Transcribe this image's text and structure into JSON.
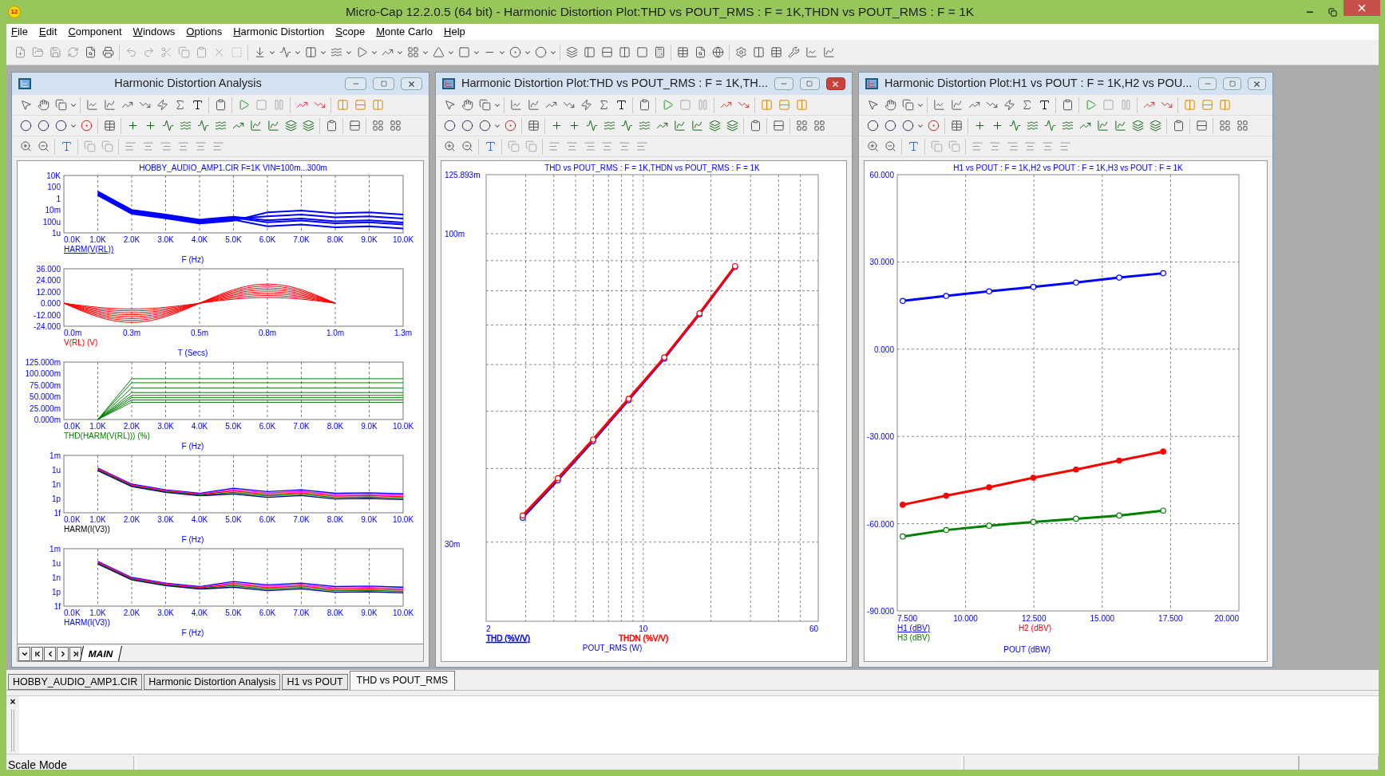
{
  "window": {
    "app_icon": "12",
    "title": "Micro-Cap 12.2.0.5 (64 bit) - Harmonic Distortion Plot:THD vs POUT_RMS : F = 1K,THDN vs POUT_RMS : F = 1K"
  },
  "menu": [
    "File",
    "Edit",
    "Component",
    "Windows",
    "Options",
    "Harmonic Distortion",
    "Scope",
    "Monte Carlo",
    "Help"
  ],
  "child_windows": [
    {
      "kind": "analysis",
      "title": "Harmonic Distortion Analysis",
      "active": false,
      "plot_title": "HOBBY_AUDIO_AMP1.CIR F=1K VIN=100m...300m",
      "page_tab": "MAIN",
      "plots": [
        {
          "kind": "spectrum",
          "yticks": [
            "10K",
            "100",
            "1",
            "10m",
            "100u",
            "1u"
          ],
          "xticks": [
            "0.0K",
            "1.0K",
            "2.0K",
            "3.0K",
            "4.0K",
            "5.0K",
            "6.0K",
            "7.0K",
            "8.0K",
            "9.0K",
            "10.0K"
          ],
          "legend": [
            {
              "text": "HARM(V(RL))",
              "color": "#0000ff",
              "selected": true
            }
          ],
          "xlabel": "F (Hz)"
        },
        {
          "kind": "sine",
          "yticks": [
            "36.000",
            "24.000",
            "12.000",
            "0.000",
            "-12.000",
            "-24.000"
          ],
          "xticks": [
            "0.0m",
            "0.3m",
            "0.5m",
            "0.8m",
            "1.0m",
            "1.3m"
          ],
          "legend": [
            {
              "text": "V(RL) (V)",
              "color": "#ff0000",
              "selected": false
            }
          ],
          "xlabel": "T (Secs)"
        },
        {
          "kind": "thd",
          "yticks": [
            "125.000m",
            "100.000m",
            "75.000m",
            "50.000m",
            "25.000m",
            "0.000m"
          ],
          "xticks": [
            "0.0K",
            "1.0K",
            "2.0K",
            "3.0K",
            "4.0K",
            "5.0K",
            "6.0K",
            "7.0K",
            "8.0K",
            "9.0K",
            "10.0K"
          ],
          "legend": [
            {
              "text": "THD(HARM(V(RL))) (%)",
              "color": "#008000",
              "selected": false
            }
          ],
          "xlabel": "F (Hz)"
        },
        {
          "kind": "multi",
          "yticks": [
            "1m",
            "1u",
            "1n",
            "1p",
            "1f"
          ],
          "xticks": [
            "0.0K",
            "1.0K",
            "2.0K",
            "3.0K",
            "4.0K",
            "5.0K",
            "6.0K",
            "7.0K",
            "8.0K",
            "9.0K",
            "10.0K"
          ],
          "legend": [
            {
              "text": "HARM(I(V3))",
              "color": "#000000",
              "selected": false
            }
          ],
          "xlabel": "F (Hz)"
        },
        {
          "kind": "multi",
          "yticks": [
            "1m",
            "1u",
            "1n",
            "1p",
            "1f"
          ],
          "xticks": [
            "0.0K",
            "1.0K",
            "2.0K",
            "3.0K",
            "4.0K",
            "5.0K",
            "6.0K",
            "7.0K",
            "8.0K",
            "9.0K",
            "10.0K"
          ],
          "legend": [
            {
              "text": "HARM(I(V3))",
              "color": "#0000ff",
              "selected": false
            }
          ],
          "xlabel": "F (Hz)"
        }
      ]
    },
    {
      "kind": "chart",
      "title": "Harmonic Distortion Plot:THD vs POUT_RMS : F = 1K,TH...",
      "active": true,
      "plot": {
        "title": "THD vs POUT_RMS : F = 1K,THDN vs POUT_RMS : F = 1K",
        "yticks": [
          "125.893m",
          "100m",
          "30m"
        ],
        "xticks": [
          "2",
          "10",
          "60"
        ],
        "legend": [
          {
            "text": "THD (%V/V)",
            "color": "#0000ff",
            "selected": true
          },
          {
            "text": "THDN (%V/V)",
            "color": "#ff0000",
            "selected": false
          }
        ],
        "xlabel": "POUT_RMS (W)"
      }
    },
    {
      "kind": "chart",
      "title": "Harmonic Distortion Plot:H1 vs POUT : F = 1K,H2 vs POU...",
      "active": false,
      "chart_data": {
        "type": "line",
        "title": "H1 vs POUT : F = 1K,H2 vs POUT : F = 1K,H3 vs POUT : F = 1K",
        "xlabel": "POUT (dBW)",
        "grid": true,
        "x": [
          7.7,
          9.29,
          10.86,
          12.48,
          14.04,
          15.62,
          17.23
        ],
        "xlim": [
          7.5,
          20
        ],
        "ylim": [
          -90,
          60
        ],
        "xticks": [
          {
            "value": 7.5,
            "label": "7.500"
          },
          {
            "value": 10,
            "label": "10.000"
          },
          {
            "value": 12.5,
            "label": "12.500"
          },
          {
            "value": 15,
            "label": "15.000"
          },
          {
            "value": 17.5,
            "label": "17.500"
          },
          {
            "value": 20,
            "label": "20.000"
          }
        ],
        "yticks": [
          {
            "value": 60,
            "label": "60.000"
          },
          {
            "value": 30,
            "label": "30.000"
          },
          {
            "value": 0,
            "label": "0.000"
          },
          {
            "value": -30,
            "label": "-30.000"
          },
          {
            "value": -60,
            "label": "-60.000"
          },
          {
            "value": -90,
            "label": "-90.000"
          }
        ],
        "series": [
          {
            "name": "H1 (dBV)",
            "color": "#0000ff",
            "marker": "circle",
            "values": [
              16.6,
              18.3,
              19.9,
              21.4,
              22.9,
              24.6,
              26.1
            ]
          },
          {
            "name": "H2 (dBV)",
            "color": "#ff0000",
            "marker": "filled-circle",
            "values": [
              -53.5,
              -50.4,
              -47.5,
              -44.2,
              -41.4,
              -38.3,
              -35.2
            ]
          },
          {
            "name": "H3 (dBV)",
            "color": "#008000",
            "marker": "circle",
            "values": [
              -64.4,
              -62.2,
              -60.7,
              -59.4,
              -58.3,
              -57.2,
              -55.5
            ]
          }
        ]
      }
    }
  ],
  "document_tabs": [
    {
      "label": "HOBBY_AUDIO_AMP1.CIR",
      "selected": false
    },
    {
      "label": "Harmonic Distortion Analysis",
      "selected": false
    },
    {
      "label": "H1 vs POUT",
      "selected": false
    },
    {
      "label": "THD vs POUT_RMS",
      "selected": true
    }
  ],
  "output_pane": {
    "close": "×"
  },
  "status_bar": {
    "mode": "Scale Mode"
  }
}
